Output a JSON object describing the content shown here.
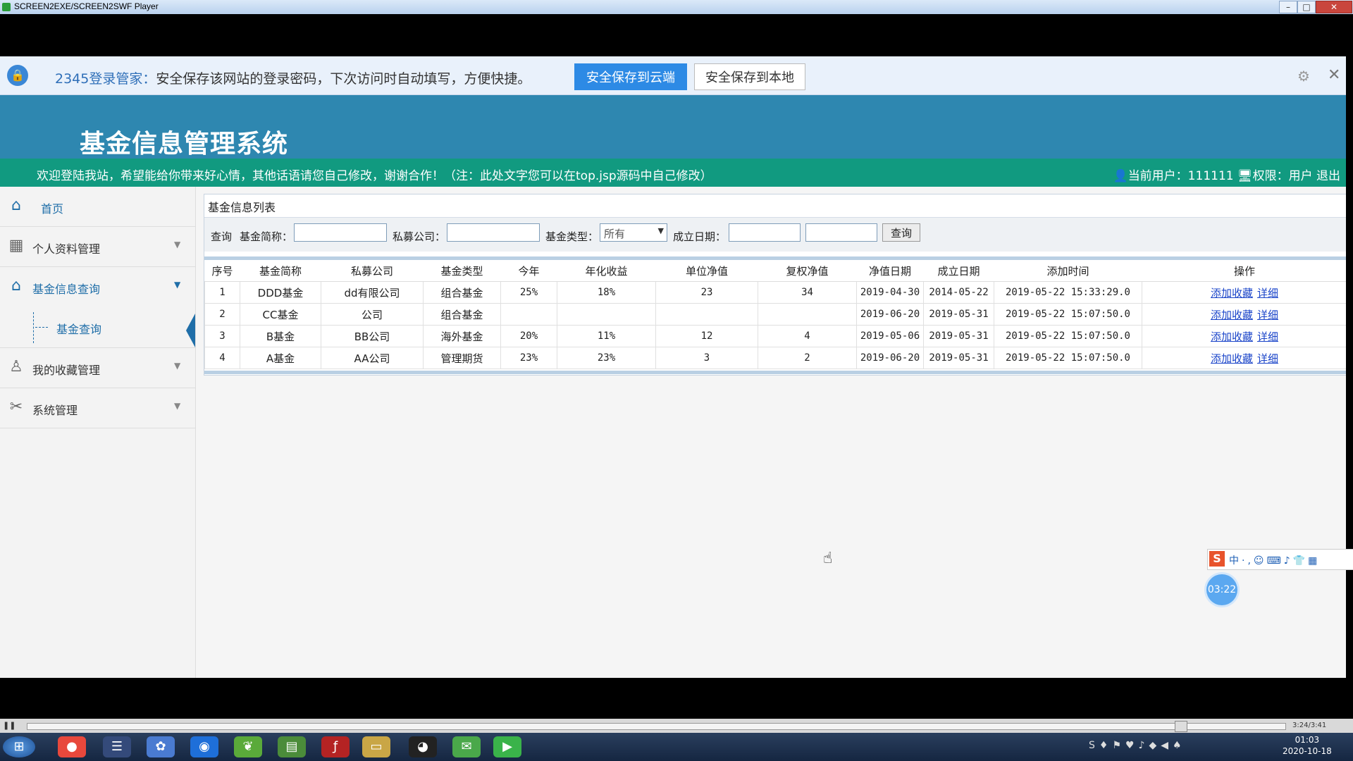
{
  "window": {
    "title": "SCREEN2EXE/SCREEN2SWF Player",
    "min": "–",
    "max": "□",
    "close": "✕"
  },
  "pwbar": {
    "brand": "2345登录管家：",
    "message": "安全保存该网站的登录密码，下次访问时自动填写，方便快捷。",
    "cloud_button": "安全保存到云端",
    "local_button": "安全保存到本地",
    "gear_icon": "⚙",
    "close_icon": "✕",
    "lock_icon": "🔒"
  },
  "header": {
    "system_name": "基金信息管理系统",
    "welcome": "欢迎登陆我站，希望能给你带来好心情，其他话语请您自己修改，谢谢合作！（注：此处文字您可以在top.jsp源码中自己修改）",
    "current_user_label": "当前用户：111111",
    "role_label": "权限：用户",
    "logout": "退出"
  },
  "sidebar": {
    "items": [
      {
        "label": "首页",
        "icon": "⌂"
      },
      {
        "label": "个人资料管理",
        "icon": "▦"
      },
      {
        "label": "基金信息查询",
        "icon": "⌂"
      },
      {
        "label": "我的收藏管理",
        "icon": "♙"
      },
      {
        "label": "系统管理",
        "icon": "✂"
      }
    ],
    "subitem": "基金查询"
  },
  "panel": {
    "title": "基金信息列表",
    "search": {
      "query_label": "查询",
      "name_label": "基金简称：",
      "company_label": "私募公司：",
      "type_label": "基金类型：",
      "type_value": "所有",
      "date_label": "成立日期：",
      "button": "查询"
    },
    "columns": [
      "序号",
      "基金简称",
      "私募公司",
      "基金类型",
      "今年",
      "年化收益",
      "单位净值",
      "复权净值",
      "净值日期",
      "成立日期",
      "添加时间",
      "操作"
    ],
    "rows": [
      [
        "1",
        "DDD基金",
        "dd有限公司",
        "组合基金",
        "25%",
        "18%",
        "23",
        "34",
        "2019-04-30",
        "2014-05-22",
        "2019-05-22 15:33:29.0"
      ],
      [
        "2",
        "CC基金",
        "公司",
        "组合基金",
        "",
        "",
        "",
        "",
        "2019-06-20",
        "2019-05-31",
        "2019-05-22 15:07:50.0"
      ],
      [
        "3",
        "B基金",
        "BB公司",
        "海外基金",
        "20%",
        "11%",
        "12",
        "4",
        "2019-05-06",
        "2019-05-31",
        "2019-05-22 15:07:50.0"
      ],
      [
        "4",
        "A基金",
        "AA公司",
        "管理期货",
        "23%",
        "23%",
        "3",
        "2",
        "2019-06-20",
        "2019-05-31",
        "2019-05-22 15:07:50.0"
      ]
    ],
    "action_favorite": "添加收藏",
    "action_detail": "详细"
  },
  "player": {
    "time": "3:24/3:41"
  },
  "ime": {
    "logo": "S",
    "items": "中·,☺⌨♪👕▦"
  },
  "timer": "03:22",
  "taskbar": {
    "time": "01:03",
    "date": "2020-10-18"
  }
}
